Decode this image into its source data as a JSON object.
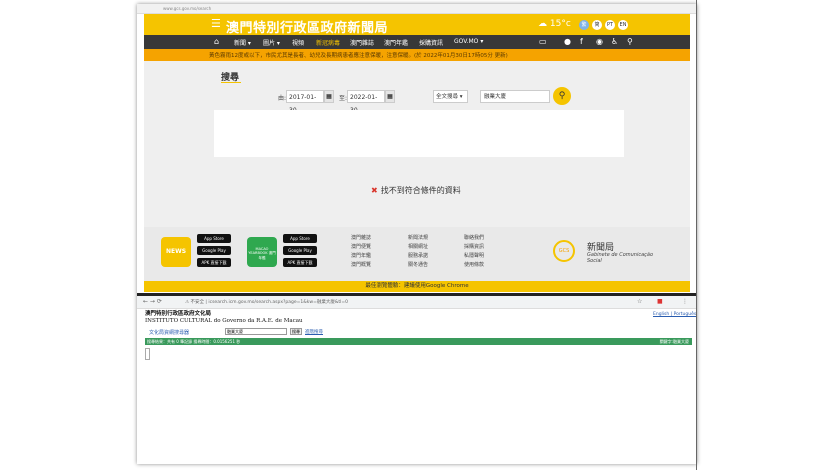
{
  "browser1": {
    "url": "www.gcs.gov.mo/search"
  },
  "header": {
    "title": "澳門特別行政區政府新聞局",
    "temperature": "15°c",
    "lang": [
      "繁",
      "简",
      "PT",
      "EN"
    ]
  },
  "nav": {
    "items": [
      "新聞",
      "圖片",
      "視頻",
      "新冠病毒",
      "澳門雜誌",
      "澳門年鑑",
      "採購資訊",
      "GOV.MO"
    ]
  },
  "notice": {
    "text": "黃色霧雨12度或以下，市民尤其是長者、幼兒及長期病患者應注意保暖，注意保暖。(於 2022年01月30日17時05分 更新)"
  },
  "search": {
    "heading": "搜尋",
    "from_label": "由:",
    "from_date": "2017-01-30",
    "to_label": "至:",
    "to_date": "2022-01-30",
    "scope": "全文搜尋",
    "keyword": "融業大廈",
    "no_results": "找不到符合條件的資料"
  },
  "footer": {
    "apps": {
      "news_label": "NEWS",
      "yearbook_label": "MACAO YEARBOOK 澳門年鑑",
      "app_store": "App Store",
      "google_play": "Google Play",
      "apk": "APK 直接下載"
    },
    "links_col1": [
      "澳門雜誌",
      "澳門便覽",
      "澳門年鑑",
      "澳門概覽"
    ],
    "links_col2": [
      "新聞法規",
      "相關網址",
      "服務承諾",
      "關冬通告"
    ],
    "links_col3": [
      "聯絡我們",
      "採購資訊",
      "私隱聲明",
      "使用條款"
    ],
    "gcs_name": "新聞局",
    "gcs_sub": "Gabinete de Comunicação Social",
    "gcs_logo": "GCS"
  },
  "chrome_notice": "最佳瀏覽體驗：建議使用Google Chrome",
  "browser2": {
    "url_prefix": "不安全",
    "url": "icsearch.icm.gov.mo/search.aspx?page=1&kw=融業大廈&tl=0",
    "org_zh": "澳門特別行政區政府文化局",
    "org_pt": "INSTITUTO CULTURAL do Governo da R.A.E. de Macau",
    "lang_links": "English | Português",
    "category": "文化局資網搜尋器",
    "search_value": "融業大廈",
    "search_button": "搜尋",
    "advanced": "進階搜尋",
    "result_summary": "搜尋結果：共有 0 筆記錄    搜尋時間：0.0156251 秒",
    "result_keyword": "關鍵字:融業大廈"
  }
}
